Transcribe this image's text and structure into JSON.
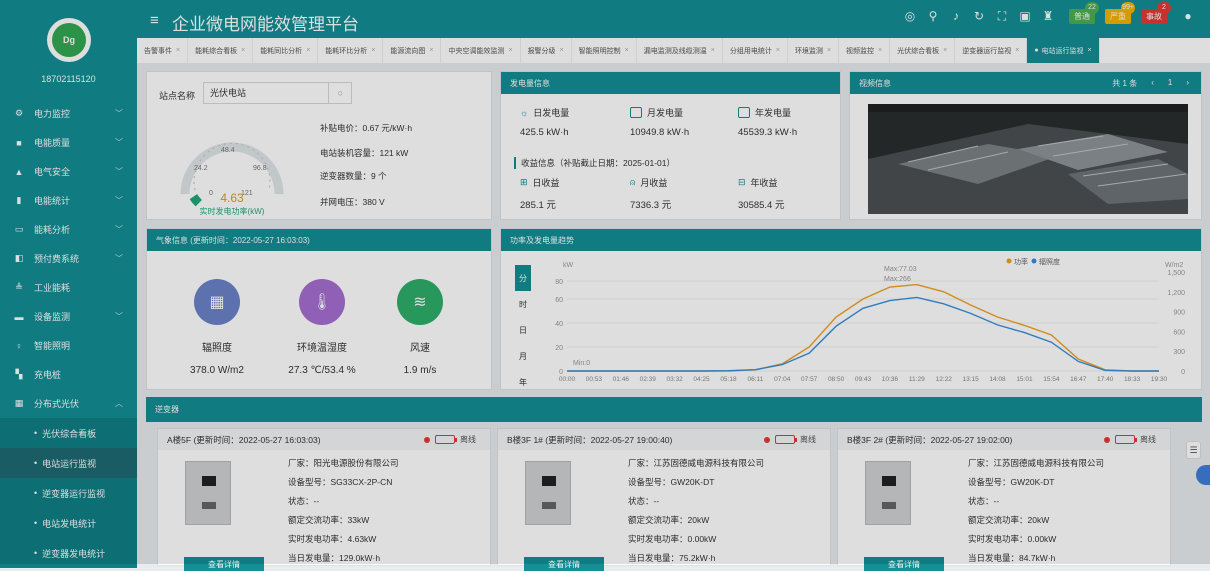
{
  "app": {
    "title": "企业微电网能效管理平台",
    "user": "18702115120",
    "logo_text": "Dg"
  },
  "sidebar": {
    "items": [
      {
        "label": "电力监控",
        "icon": "⚙"
      },
      {
        "label": "电能质量",
        "icon": "■"
      },
      {
        "label": "电气安全",
        "icon": "▲"
      },
      {
        "label": "电能统计",
        "icon": "▮"
      },
      {
        "label": "能耗分析",
        "icon": "▭"
      },
      {
        "label": "预付费系统",
        "icon": "◧"
      },
      {
        "label": "工业能耗",
        "icon": "≜"
      },
      {
        "label": "设备监测",
        "icon": "▬"
      },
      {
        "label": "智能照明",
        "icon": "♀"
      },
      {
        "label": "充电桩",
        "icon": "▚"
      },
      {
        "label": "分布式光伏",
        "icon": "▦"
      }
    ],
    "sub": [
      "光伏综合看板",
      "电站运行监视",
      "逆变器运行监视",
      "电站发电统计",
      "逆变器发电统计"
    ]
  },
  "header_badges": [
    {
      "label": "普通",
      "count": "22",
      "color": "#4caf50"
    },
    {
      "label": "严重",
      "count": "99+",
      "color": "#f4b400"
    },
    {
      "label": "事故",
      "count": "2",
      "color": "#e53935"
    }
  ],
  "tabs": [
    "告警事件",
    "能耗综合看板",
    "能耗同比分析",
    "能耗环比分析",
    "能源流向图",
    "中央空调能效监测",
    "报警分级",
    "智能照明控制",
    "漏电监测及线缆测温",
    "分组用电统计",
    "环境监测",
    "视频监控",
    "光伏综合看板",
    "逆变器运行监视",
    "电站运行监视"
  ],
  "station": {
    "label": "站点名称",
    "value": "光伏电站",
    "search_icon": "○",
    "gauge_value": "4.63",
    "gauge_label": "实时发电功率(kW)",
    "gauge_ticks": [
      "24.2",
      "48.4",
      "72.6",
      "96.8",
      "121",
      "0"
    ],
    "info": [
      "补贴电价：0.67 元/kW·h",
      "电站装机容量：121 kW",
      "逆变器数量：9 个",
      "并网电压：380 V"
    ],
    "gauge_value_num": 4.63,
    "gauge_max": 121
  },
  "gen": {
    "title": "发电量信息",
    "items": [
      {
        "label": "日发电量",
        "value": "425.5 kW·h"
      },
      {
        "label": "月发电量",
        "value": "10949.8 kW·h"
      },
      {
        "label": "年发电量",
        "value": "45539.3 kW·h"
      }
    ],
    "income_title": "收益信息（补贴截止日期：2025-01-01）",
    "income": [
      {
        "label": "日收益",
        "value": "285.1 元"
      },
      {
        "label": "月收益",
        "value": "7336.3 元"
      },
      {
        "label": "年收益",
        "value": "30585.4 元"
      }
    ]
  },
  "video": {
    "title": "视频信息",
    "pager": "共 1 条",
    "page": "1",
    "prev": "‹",
    "next": "›"
  },
  "weather": {
    "title": "气象信息 (更新时间：2022-05-27 16:03:03)",
    "items": [
      {
        "label": "辐照度",
        "value": "378.0 W/m2",
        "color": "#6c82c9",
        "icon": "▦"
      },
      {
        "label": "环境温湿度",
        "value": "27.3 ℃/53.4 %",
        "color": "#a56fd0",
        "icon": "🌡"
      },
      {
        "label": "风速",
        "value": "1.9 m/s",
        "color": "#2fae6a",
        "icon": "≋"
      }
    ]
  },
  "trend": {
    "title": "功率及发电量趋势",
    "side_tabs": [
      "分",
      "时",
      "日",
      "月",
      "年"
    ],
    "legend": [
      "功率",
      "辐照度"
    ],
    "ylabel_left": "kW",
    "ylabel_right": "W/m2",
    "y_left": [
      "80",
      "60",
      "40",
      "20",
      "0"
    ],
    "y_right": [
      "1,500",
      "1,200",
      "900",
      "600",
      "300",
      "0"
    ],
    "x": [
      "00:00",
      "00:53",
      "01:46",
      "02:39",
      "03:32",
      "04:25",
      "05:18",
      "06:11",
      "07:04",
      "07:57",
      "08:50",
      "09:43",
      "10:36",
      "11:29",
      "12:22",
      "13:15",
      "14:08",
      "15:01",
      "15:54",
      "16:47",
      "17:40",
      "18:33",
      "19:30"
    ],
    "max_label": "Max:77.03",
    "max2_label": "Max:266",
    "min_label": "Min:0"
  },
  "chart_data": {
    "type": "line",
    "title": "功率及发电量趋势",
    "x": [
      "00:00",
      "00:53",
      "01:46",
      "02:39",
      "03:32",
      "04:25",
      "05:18",
      "06:11",
      "07:04",
      "07:57",
      "08:50",
      "09:43",
      "10:36",
      "11:29",
      "12:22",
      "13:15",
      "14:08",
      "15:01",
      "15:54",
      "16:47",
      "17:40",
      "18:33",
      "19:30"
    ],
    "series": [
      {
        "name": "功率",
        "color": "#f0a020",
        "values": [
          0,
          0,
          0,
          0,
          0,
          0,
          0,
          1,
          6,
          20,
          45,
          60,
          70,
          72,
          66,
          55,
          45,
          38,
          30,
          10,
          1,
          0,
          0
        ]
      },
      {
        "name": "辐照度",
        "color": "#3a8fd9",
        "values": [
          0,
          0,
          0,
          0,
          0,
          0,
          5,
          20,
          100,
          280,
          700,
          980,
          1100,
          1150,
          1050,
          900,
          720,
          600,
          450,
          150,
          10,
          0,
          0
        ]
      }
    ],
    "ylim_left": [
      0,
      80
    ],
    "ylim_right": [
      0,
      1500
    ]
  },
  "inverter": {
    "title": "逆变器",
    "detail": "查看详情",
    "status_text": "离线",
    "cards": [
      {
        "name": "A楼5F (更新时间：2022-05-27 16:03:03)",
        "kv": [
          "厂家：阳光电源股份有限公司",
          "设备型号：SG33CX-2P-CN",
          "状态：--",
          "额定交流功率：33kW",
          "实时发电功率：4.63kW",
          "当日发电量：129.0kW·h"
        ]
      },
      {
        "name": "B楼3F 1# (更新时间：2022-05-27 19:00:40)",
        "kv": [
          "厂家：江苏固德威电源科技有限公司",
          "设备型号：GW20K-DT",
          "状态：--",
          "额定交流功率：20kW",
          "实时发电功率：0.00kW",
          "当日发电量：75.2kW·h"
        ]
      },
      {
        "name": "B楼3F 2# (更新时间：2022-05-27 19:02:00)",
        "kv": [
          "厂家：江苏固德威电源科技有限公司",
          "设备型号：GW20K-DT",
          "状态：--",
          "额定交流功率：20kW",
          "实时发电功率：0.00kW",
          "当日发电量：84.7kW·h"
        ]
      }
    ]
  }
}
